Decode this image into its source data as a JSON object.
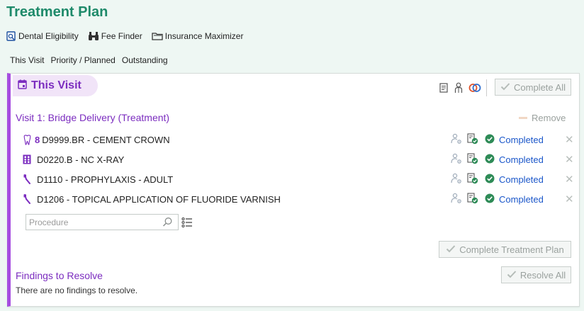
{
  "page": {
    "title": "Treatment Plan"
  },
  "toolbar": {
    "items": [
      {
        "label": "Dental Eligibility",
        "icon": "eligibility-icon"
      },
      {
        "label": "Fee Finder",
        "icon": "binoculars-icon"
      },
      {
        "label": "Insurance Maximizer",
        "icon": "folder-icon"
      }
    ]
  },
  "tabs": [
    "This Visit",
    "Priority / Planned",
    "Outstanding"
  ],
  "visit_card": {
    "title": "This Visit",
    "complete_all_label": "Complete All",
    "visit_heading": "Visit 1: Bridge Delivery (Treatment)",
    "remove_label": "Remove",
    "procedures": [
      {
        "tooth": "8",
        "code_desc": "D9999.BR - CEMENT CROWN",
        "type_icon": "tooth-icon",
        "status": "Completed"
      },
      {
        "tooth": "",
        "code_desc": "D0220.B - NC X-RAY",
        "type_icon": "xray-icon",
        "status": "Completed"
      },
      {
        "tooth": "",
        "code_desc": "D1110 - PROPHYLAXIS - ADULT",
        "type_icon": "toothbrush-icon",
        "status": "Completed"
      },
      {
        "tooth": "",
        "code_desc": "D1206 - TOPICAL APPLICATION OF FLUORIDE VARNISH",
        "type_icon": "toothbrush-icon",
        "status": "Completed"
      }
    ],
    "procedure_placeholder": "Procedure",
    "complete_plan_label": "Complete Treatment Plan",
    "findings_title": "Findings to Resolve",
    "findings_text": "There are no findings to resolve.",
    "resolve_all_label": "Resolve All"
  },
  "colors": {
    "accent_green": "#1e8a6a",
    "accent_purple": "#7b2cbf",
    "status_green": "#2e8b57",
    "link_blue": "#1a56c9",
    "background": "#eef7f3"
  }
}
